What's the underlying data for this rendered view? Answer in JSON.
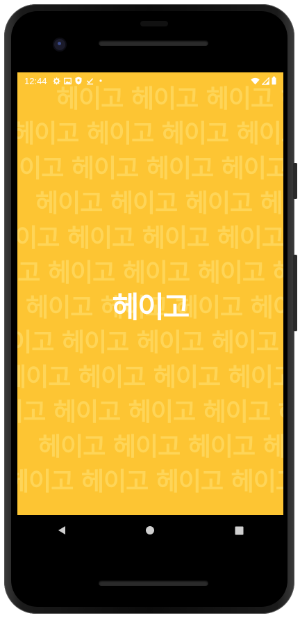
{
  "status_bar": {
    "time": "12:44",
    "left_icons": [
      "gear-icon",
      "image-icon",
      "shield-icon",
      "download-done-icon",
      "dot-icon"
    ],
    "right_icons": [
      "wifi-icon",
      "signal-icon",
      "battery-icon"
    ],
    "text_color": "#ffffff"
  },
  "splash": {
    "background_color": "#fdc533",
    "logo_text": "헤이고",
    "logo_color": "#ffffff",
    "pattern_text": "헤이고 헤이고 헤이고 헤이고 헤이고",
    "pattern_color": "#ffd85f"
  },
  "nav_bar": {
    "buttons": [
      "back-icon",
      "home-icon",
      "recents-icon"
    ]
  },
  "device": {
    "frame_color": "#111111"
  }
}
